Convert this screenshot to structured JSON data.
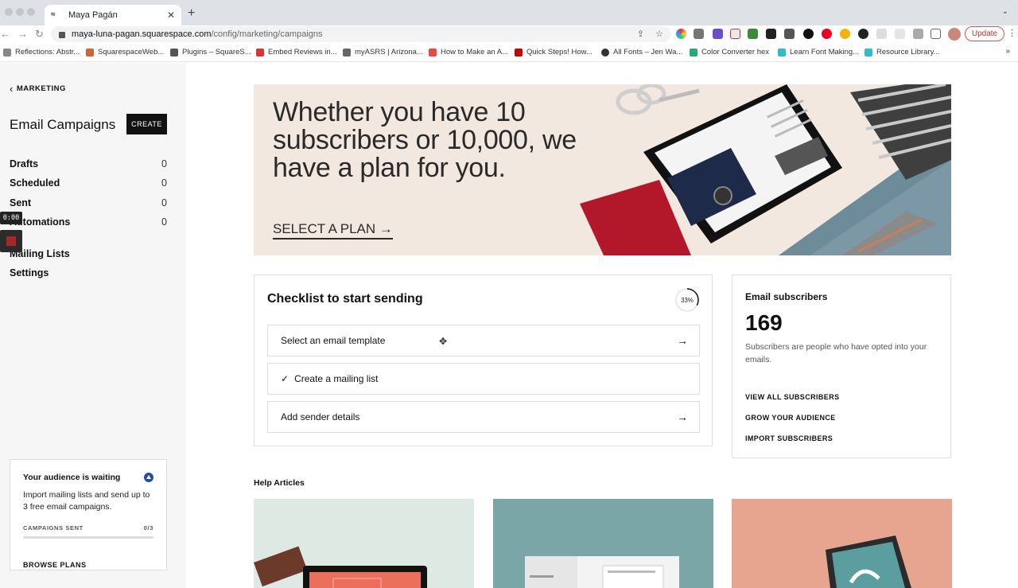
{
  "browser": {
    "tab_title": "Maya Pagán",
    "url_host": "maya-luna-pagan.squarespace.com",
    "url_path": "/config/marketing/campaigns",
    "update_label": "Update",
    "bookmarks": [
      "Reflections: Abstr...",
      "SquarespaceWeb...",
      "Plugins – SquareS...",
      "Embed Reviews in...",
      "myASRS | Arizona...",
      "How to Make an A...",
      "Quick Steps! How...",
      "All Fonts – Jen Wa...",
      "Color Converter hex",
      "Learn Font Making...",
      "Resource Library..."
    ]
  },
  "sidebar": {
    "back_label": "MARKETING",
    "title": "Email Campaigns",
    "create_label": "CREATE",
    "items": [
      {
        "label": "Drafts",
        "count": "0"
      },
      {
        "label": "Scheduled",
        "count": "0"
      },
      {
        "label": "Sent",
        "count": "0"
      },
      {
        "label": "Automations",
        "count": "0"
      },
      {
        "label": "Mailing Lists",
        "count": ""
      },
      {
        "label": "Settings",
        "count": ""
      }
    ],
    "recorder_time": "0:00",
    "audience": {
      "title": "Your audience is waiting",
      "text": "Import mailing lists and send up to 3 free email campaigns.",
      "meta_label": "CAMPAIGNS SENT",
      "meta_value": "0/3",
      "progress": 0,
      "browse_label": "BROWSE PLANS"
    }
  },
  "hero": {
    "headline": "Whether you have 10 subscribers or 10,000, we have a plan for you.",
    "cta": "SELECT A PLAN →"
  },
  "checklist": {
    "title": "Checklist to start sending",
    "percent": "33%",
    "progress": 0.33,
    "tasks": [
      {
        "label": "Select an email template",
        "done": false
      },
      {
        "label": "Create a mailing list",
        "done": true
      },
      {
        "label": "Add sender details",
        "done": false
      }
    ]
  },
  "subscribers": {
    "title": "Email subscribers",
    "count": "169",
    "description": "Subscribers are people who have opted into your emails.",
    "links": [
      "VIEW ALL SUBSCRIBERS",
      "GROW YOUR AUDIENCE",
      "IMPORT SUBSCRIBERS"
    ]
  },
  "help": {
    "title": "Help Articles"
  },
  "colors": {
    "hero_bg": "#f2e8df",
    "article_1_bg": "#dfe9e4",
    "article_2_bg": "#7aa6a8",
    "article_3_bg": "#e7a48e",
    "dark": "#111111"
  }
}
